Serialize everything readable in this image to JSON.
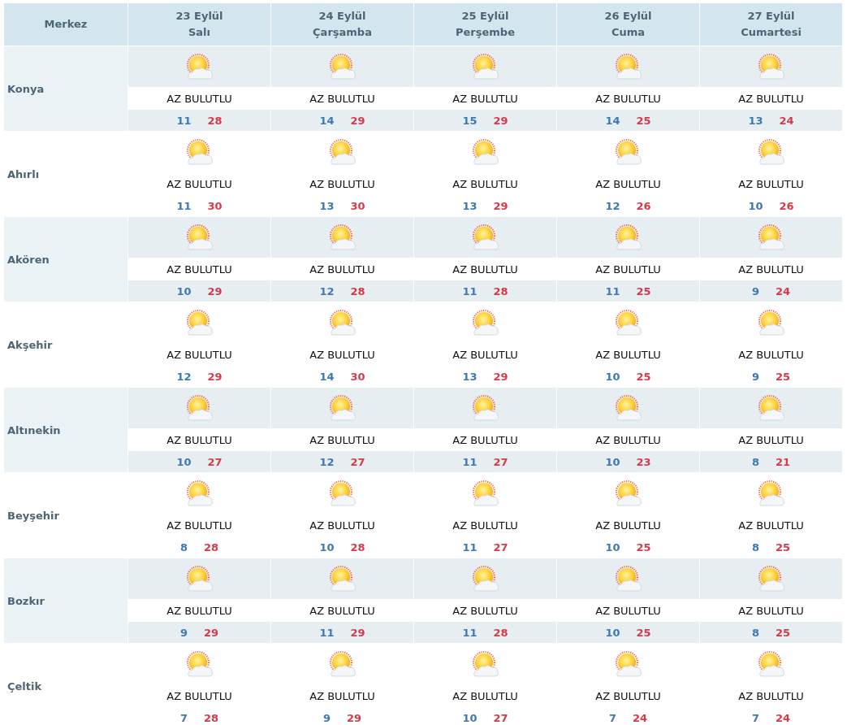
{
  "header": {
    "label": "Merkez"
  },
  "days": [
    {
      "date": "23 Eylül",
      "weekday": "Salı"
    },
    {
      "date": "24 Eylül",
      "weekday": "Çarşamba"
    },
    {
      "date": "25 Eylül",
      "weekday": "Perşembe"
    },
    {
      "date": "26 Eylül",
      "weekday": "Cuma"
    },
    {
      "date": "27 Eylül",
      "weekday": "Cumartesi"
    }
  ],
  "cities": [
    {
      "name": "Konya",
      "forecasts": [
        {
          "condition": "AZ BULUTLU",
          "low": "11",
          "high": "28"
        },
        {
          "condition": "AZ BULUTLU",
          "low": "14",
          "high": "29"
        },
        {
          "condition": "AZ BULUTLU",
          "low": "15",
          "high": "29"
        },
        {
          "condition": "AZ BULUTLU",
          "low": "14",
          "high": "25"
        },
        {
          "condition": "AZ BULUTLU",
          "low": "13",
          "high": "24"
        }
      ]
    },
    {
      "name": "Ahırlı",
      "forecasts": [
        {
          "condition": "AZ BULUTLU",
          "low": "11",
          "high": "30"
        },
        {
          "condition": "AZ BULUTLU",
          "low": "13",
          "high": "30"
        },
        {
          "condition": "AZ BULUTLU",
          "low": "13",
          "high": "29"
        },
        {
          "condition": "AZ BULUTLU",
          "low": "12",
          "high": "26"
        },
        {
          "condition": "AZ BULUTLU",
          "low": "10",
          "high": "26"
        }
      ]
    },
    {
      "name": "Akören",
      "forecasts": [
        {
          "condition": "AZ BULUTLU",
          "low": "10",
          "high": "29"
        },
        {
          "condition": "AZ BULUTLU",
          "low": "12",
          "high": "28"
        },
        {
          "condition": "AZ BULUTLU",
          "low": "11",
          "high": "28"
        },
        {
          "condition": "AZ BULUTLU",
          "low": "11",
          "high": "25"
        },
        {
          "condition": "AZ BULUTLU",
          "low": "9",
          "high": "24"
        }
      ]
    },
    {
      "name": "Akşehir",
      "forecasts": [
        {
          "condition": "AZ BULUTLU",
          "low": "12",
          "high": "29"
        },
        {
          "condition": "AZ BULUTLU",
          "low": "14",
          "high": "30"
        },
        {
          "condition": "AZ BULUTLU",
          "low": "13",
          "high": "29"
        },
        {
          "condition": "AZ BULUTLU",
          "low": "10",
          "high": "25"
        },
        {
          "condition": "AZ BULUTLU",
          "low": "9",
          "high": "25"
        }
      ]
    },
    {
      "name": "Altınekin",
      "forecasts": [
        {
          "condition": "AZ BULUTLU",
          "low": "10",
          "high": "27"
        },
        {
          "condition": "AZ BULUTLU",
          "low": "12",
          "high": "27"
        },
        {
          "condition": "AZ BULUTLU",
          "low": "11",
          "high": "27"
        },
        {
          "condition": "AZ BULUTLU",
          "low": "10",
          "high": "23"
        },
        {
          "condition": "AZ BULUTLU",
          "low": "8",
          "high": "21"
        }
      ]
    },
    {
      "name": "Beyşehir",
      "forecasts": [
        {
          "condition": "AZ BULUTLU",
          "low": "8",
          "high": "28"
        },
        {
          "condition": "AZ BULUTLU",
          "low": "10",
          "high": "28"
        },
        {
          "condition": "AZ BULUTLU",
          "low": "11",
          "high": "27"
        },
        {
          "condition": "AZ BULUTLU",
          "low": "10",
          "high": "25"
        },
        {
          "condition": "AZ BULUTLU",
          "low": "8",
          "high": "25"
        }
      ]
    },
    {
      "name": "Bozkır",
      "forecasts": [
        {
          "condition": "AZ BULUTLU",
          "low": "9",
          "high": "29"
        },
        {
          "condition": "AZ BULUTLU",
          "low": "11",
          "high": "29"
        },
        {
          "condition": "AZ BULUTLU",
          "low": "11",
          "high": "28"
        },
        {
          "condition": "AZ BULUTLU",
          "low": "10",
          "high": "25"
        },
        {
          "condition": "AZ BULUTLU",
          "low": "8",
          "high": "25"
        }
      ]
    },
    {
      "name": "Çeltik",
      "forecasts": [
        {
          "condition": "AZ BULUTLU",
          "low": "7",
          "high": "28"
        },
        {
          "condition": "AZ BULUTLU",
          "low": "9",
          "high": "29"
        },
        {
          "condition": "AZ BULUTLU",
          "low": "10",
          "high": "27"
        },
        {
          "condition": "AZ BULUTLU",
          "low": "7",
          "high": "24"
        },
        {
          "condition": "AZ BULUTLU",
          "low": "7",
          "high": "24"
        }
      ]
    }
  ]
}
